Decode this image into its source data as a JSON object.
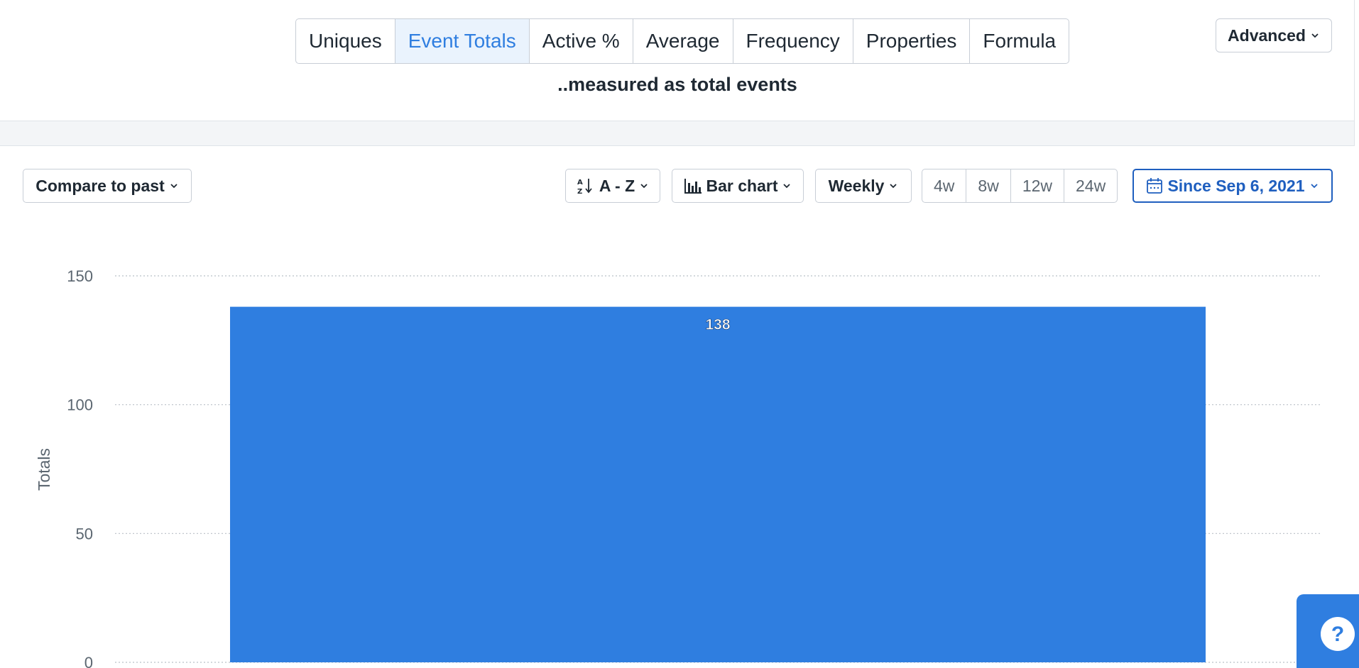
{
  "metric_tabs": [
    {
      "label": "Uniques",
      "active": false
    },
    {
      "label": "Event Totals",
      "active": true
    },
    {
      "label": "Active %",
      "active": false
    },
    {
      "label": "Average",
      "active": false
    },
    {
      "label": "Frequency",
      "active": false
    },
    {
      "label": "Properties",
      "active": false
    },
    {
      "label": "Formula",
      "active": false
    }
  ],
  "measured_caption": "..measured as total events",
  "advanced_label": "Advanced",
  "controls": {
    "compare_label": "Compare to past",
    "sort_label": "A - Z",
    "chart_type_label": "Bar chart",
    "interval_label": "Weekly",
    "ranges": [
      "4w",
      "8w",
      "12w",
      "24w"
    ],
    "date_label": "Since Sep 6, 2021"
  },
  "icons": {
    "sort": "sort-alpha-icon",
    "chart_type": "bar-chart-icon",
    "date": "calendar-icon",
    "help": "question-mark-icon"
  },
  "colors": {
    "accent": "#2f7ee0",
    "active_tab_bg": "#eaf3fd",
    "date_border": "#1f5fbf",
    "bar": "#2f7ee0"
  },
  "help_label": "?",
  "chart_data": {
    "type": "bar",
    "categories": [
      ""
    ],
    "values": [
      138
    ],
    "data_labels": [
      "138"
    ],
    "ylabel": "Totals",
    "ylim": [
      0,
      150
    ],
    "yticks": [
      0,
      50,
      100,
      150
    ],
    "grid": true
  }
}
